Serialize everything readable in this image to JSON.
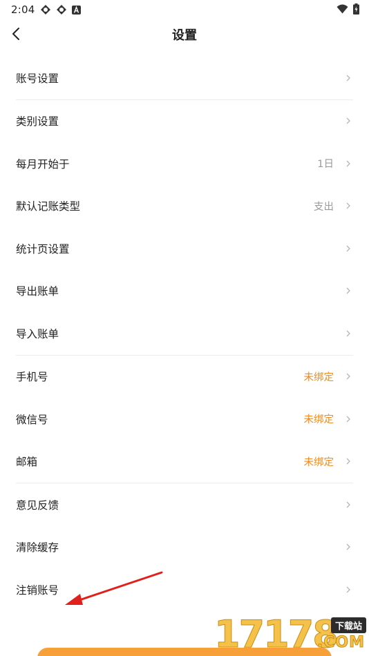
{
  "status_bar": {
    "time": "2:04"
  },
  "nav": {
    "title": "设置"
  },
  "groups": [
    {
      "rows": [
        {
          "label": "账号设置",
          "value": ""
        }
      ]
    },
    {
      "rows": [
        {
          "label": "类别设置",
          "value": ""
        },
        {
          "label": "每月开始于",
          "value": "1日"
        },
        {
          "label": "默认记账类型",
          "value": "支出"
        },
        {
          "label": "统计页设置",
          "value": ""
        },
        {
          "label": "导出账单",
          "value": ""
        },
        {
          "label": "导入账单",
          "value": ""
        }
      ]
    },
    {
      "rows": [
        {
          "label": "手机号",
          "value": "未绑定"
        },
        {
          "label": "微信号",
          "value": "未绑定"
        },
        {
          "label": "邮箱",
          "value": "未绑定"
        }
      ]
    },
    {
      "rows": [
        {
          "label": "意见反馈",
          "value": ""
        },
        {
          "label": "清除缓存",
          "value": ""
        },
        {
          "label": "注销账号",
          "value": ""
        }
      ]
    }
  ],
  "watermark": {
    "number": "17178",
    "badge": "下载站",
    "suffix": ".COM"
  },
  "colors": {
    "warn": "#f28a1c",
    "muted": "#9a9a9a",
    "accent": "#f7a03a",
    "annotation": "#e0201c"
  },
  "icons": {
    "back": "chevron-left-icon",
    "row": "chevron-right-icon"
  }
}
